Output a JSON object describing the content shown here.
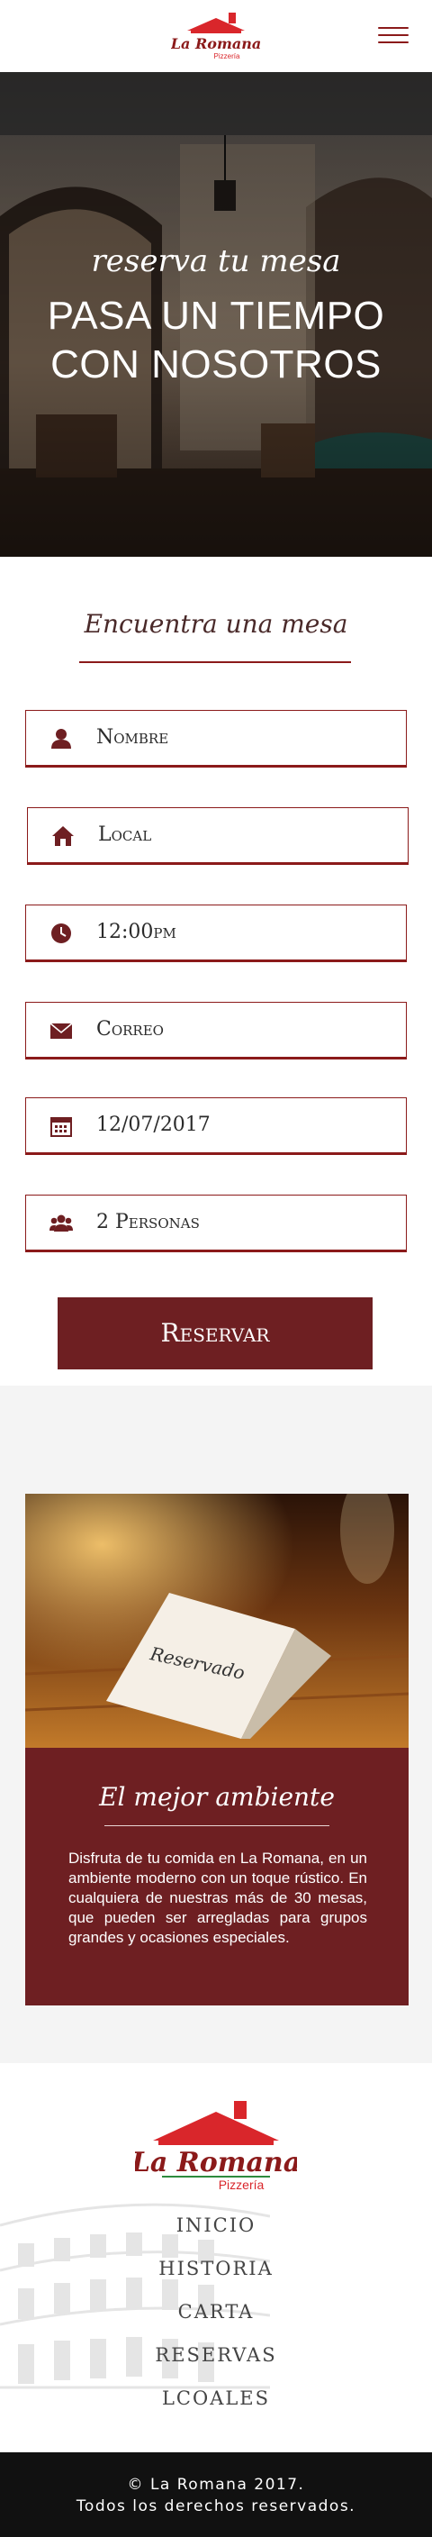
{
  "header": {
    "logo_name": "La Romana",
    "logo_sub": "Pizzería",
    "menu_icon": "hamburger-menu-icon"
  },
  "hero": {
    "script": "reserva tu mesa",
    "title_line1": "PASA UN TIEMPO",
    "title_line2": "CON NOSOTROS"
  },
  "reservation": {
    "title": "Encuentra una mesa",
    "fields": [
      {
        "icon": "user-icon",
        "value": "Nombre"
      },
      {
        "icon": "home-icon",
        "value": "Local"
      },
      {
        "icon": "clock-icon",
        "value": "12:00pm"
      },
      {
        "icon": "envelope-icon",
        "value": "Correo"
      },
      {
        "icon": "calendar-icon",
        "value": "12/07/2017"
      },
      {
        "icon": "users-icon",
        "value": "2 Personas"
      }
    ],
    "submit_label": "Reservar"
  },
  "ambiente": {
    "card_sign": "Reservado",
    "title": "El mejor ambiente",
    "text": "Disfruta de tu comida en La Romana, en un ambiente moderno con un toque rústico. En cualquiera de nuestras más de 30 mesas, que pueden ser arregladas para grupos grandes y ocasiones especiales."
  },
  "footer": {
    "logo_name": "La Romana",
    "logo_sub": "Pizzería",
    "nav": [
      "INICIO",
      "HISTORIA",
      "CARTA",
      "RESERVAS",
      "LCOALES"
    ],
    "copyright_line1": "© La Romana 2017.",
    "copyright_line2": "Todos los derechos reservados."
  },
  "colors": {
    "brand": "#6e1f22",
    "logo_red": "#d9262b",
    "border": "#8b1a1a"
  }
}
